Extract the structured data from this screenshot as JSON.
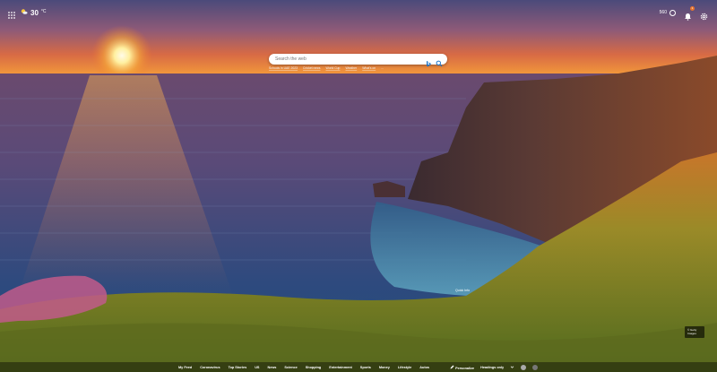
{
  "weather": {
    "temp": "30",
    "unit": "°C",
    "icon": "sun-cloud-icon"
  },
  "header": {
    "apps_icon": "apps-grid-icon",
    "points": "560",
    "notifications_badge": "1"
  },
  "search": {
    "placeholder": "Search the web",
    "bing_icon": "bing-logo-icon",
    "search_icon": "search-icon"
  },
  "quick_links": [
    "Schools in UAE 2023",
    "Cricket news",
    "World Cup",
    "Weather",
    "What's on",
    "..."
  ],
  "background": {
    "quick_info_label": "Quick Info",
    "image_info": [
      "© Getty",
      "Images"
    ]
  },
  "feed": {
    "tabs": [
      "My Feed",
      "Coronavirus",
      "Top Stories",
      "US",
      "News",
      "Science",
      "Shopping",
      "Entertainment",
      "Sports",
      "Money",
      "Lifestyle",
      "Autos"
    ],
    "personalize": "Personalize",
    "heading_visibility": "Headings only"
  },
  "colors": {
    "sky_top": "#4b4a7a",
    "sunset_orange": "#f3852a",
    "sea": "#2d4470",
    "grass": "#8c8f24"
  }
}
